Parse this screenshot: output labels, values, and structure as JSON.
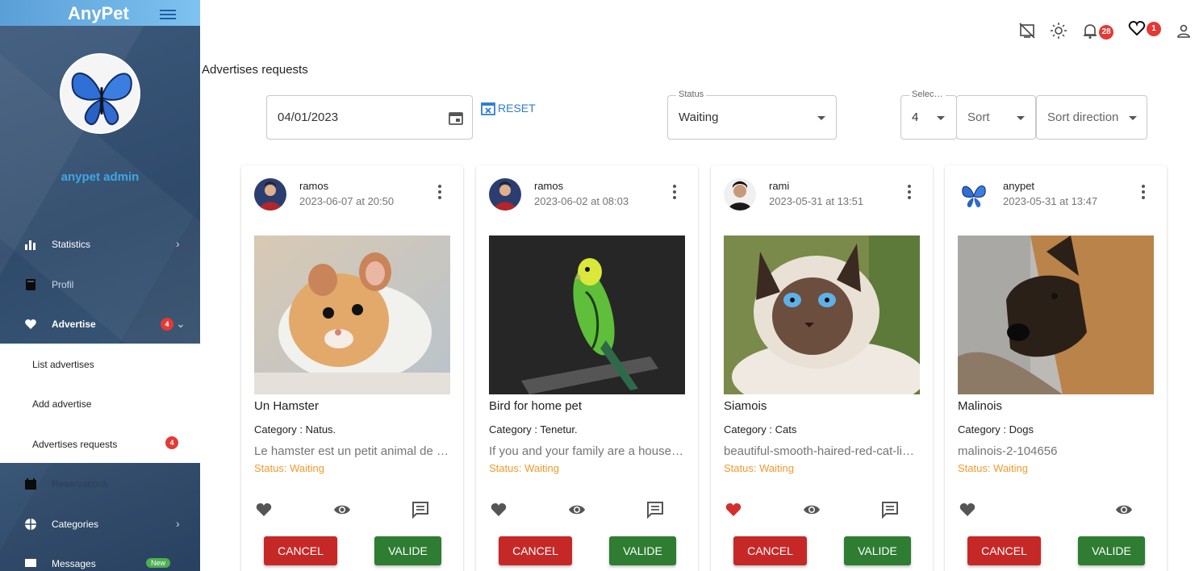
{
  "app": {
    "name": "AnyPet"
  },
  "sidebar": {
    "user_name": "anypet admin",
    "items": [
      {
        "label": "Statistics",
        "icon": "bar-chart-icon"
      },
      {
        "label": "Profil",
        "icon": "book-icon"
      },
      {
        "label": "Advertise",
        "icon": "heart-icon",
        "badge": "4"
      },
      {
        "label": "Reservations",
        "icon": "calendar-icon"
      },
      {
        "label": "Categories",
        "icon": "globe-icon"
      },
      {
        "label": "Messages",
        "icon": "chat-icon",
        "badge": "New"
      }
    ],
    "submenu": [
      {
        "label": "List advertises"
      },
      {
        "label": "Add advertise"
      },
      {
        "label": "Advertises requests",
        "badge": "4"
      }
    ]
  },
  "header": {
    "notifications_count": "28",
    "favorites_count": "1"
  },
  "page": {
    "title": "Advertises requests"
  },
  "filters": {
    "date": "04/01/2023",
    "reset_label": "RESET",
    "status_legend": "Status",
    "status_value": "Waiting",
    "select_legend": "Selec…",
    "select_value": "4",
    "sort_label": "Sort",
    "sort_direction_label": "Sort direction"
  },
  "cards": [
    {
      "user": "ramos",
      "date": "2023-06-07 at 20:50",
      "title": "Un Hamster",
      "category_label": "Category : ",
      "category": "Natus.",
      "description": "Le hamster est un petit animal de compagnie très apprécié",
      "status": "Status: Waiting",
      "cancel": "CANCEL",
      "valide": "VALIDE",
      "liked": false
    },
    {
      "user": "ramos",
      "date": "2023-06-02 at 08:03",
      "title": "Bird for home pet",
      "category_label": "Category : ",
      "category": "Tenetur.",
      "description": "If you and your family are a household looking for a bird",
      "status": "Status: Waiting",
      "cancel": "CANCEL",
      "valide": "VALIDE",
      "liked": false
    },
    {
      "user": "rami",
      "date": "2023-05-31 at 13:51",
      "title": "Siamois",
      "category_label": "Category : ",
      "category": "Cats",
      "description": "beautiful-smooth-haired-red-cat-lies-on-the-sofa",
      "status": "Status: Waiting",
      "cancel": "CANCEL",
      "valide": "VALIDE",
      "liked": true
    },
    {
      "user": "anypet",
      "date": "2023-05-31 at 13:47",
      "title": "Malinois",
      "category_label": "Category : ",
      "category": "Dogs",
      "description": "malinois-2-104656",
      "status": "Status: Waiting",
      "cancel": "CANCEL",
      "valide": "VALIDE",
      "liked": false
    }
  ],
  "colors": {
    "accent": "#2f7dd0",
    "cancel": "#c62828",
    "valide": "#2e7d32",
    "status": "#f39a2b",
    "badge": "#e53935"
  }
}
